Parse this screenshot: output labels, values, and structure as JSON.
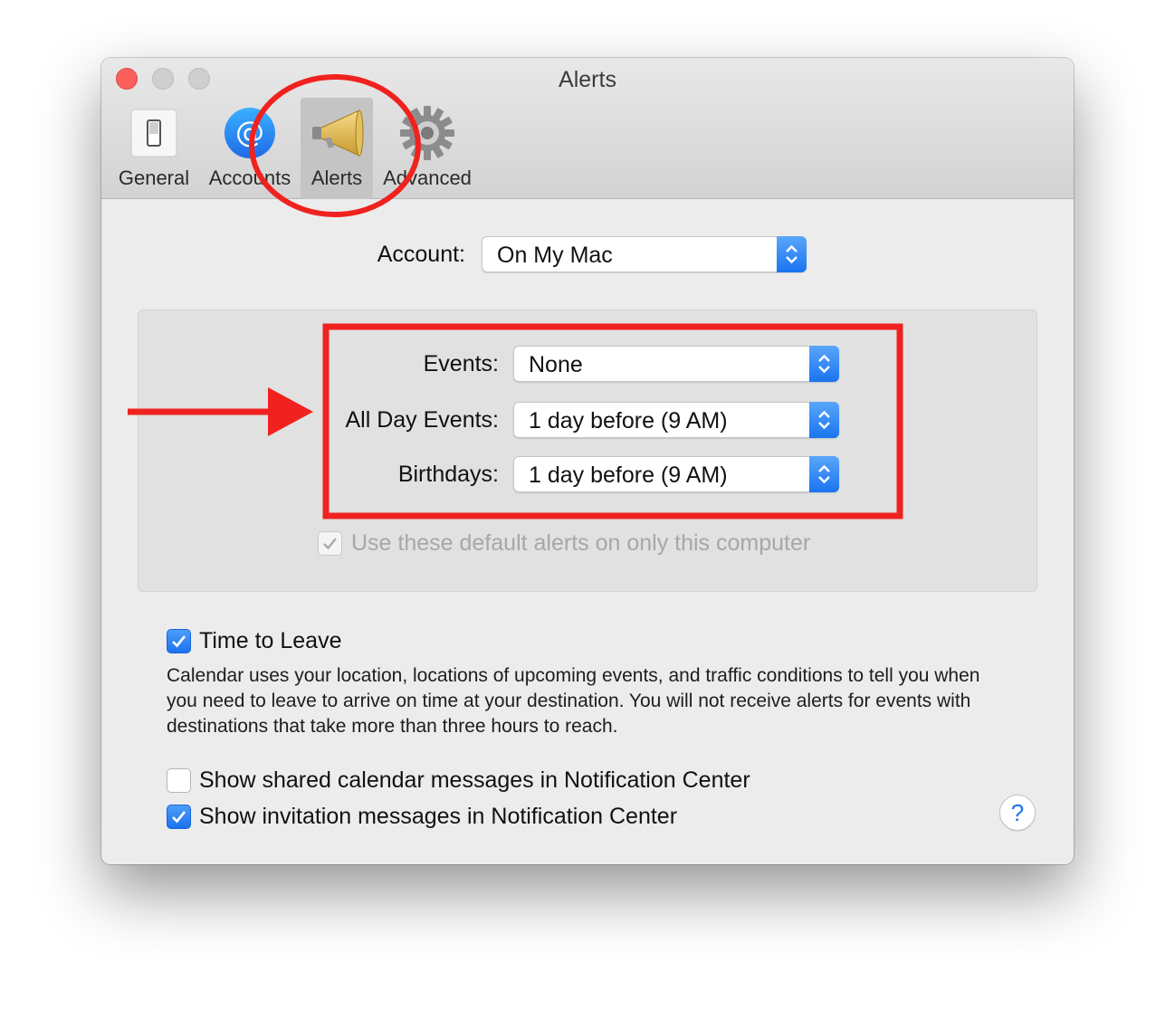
{
  "window": {
    "title": "Alerts",
    "controls": [
      "close",
      "minimize",
      "zoom"
    ]
  },
  "toolbar": {
    "items": [
      {
        "label": "General",
        "icon": "switch-icon",
        "selected": false
      },
      {
        "label": "Accounts",
        "icon": "at-sign-icon",
        "selected": false
      },
      {
        "label": "Alerts",
        "icon": "megaphone-icon",
        "selected": true
      },
      {
        "label": "Advanced",
        "icon": "gear-icon",
        "selected": false
      }
    ]
  },
  "account": {
    "label": "Account:",
    "value": "On My Mac"
  },
  "defaults": {
    "events_label": "Events:",
    "events_value": "None",
    "all_day_label": "All Day Events:",
    "all_day_value": "1 day before (9 AM)",
    "birthdays_label": "Birthdays:",
    "birthdays_value": "1 day before (9 AM)",
    "only_this_computer_label": "Use these default alerts on only this computer",
    "only_this_computer_checked": true,
    "only_this_computer_enabled": false
  },
  "time_to_leave": {
    "label": "Time to Leave",
    "checked": true,
    "description": "Calendar uses your location, locations of upcoming events, and traffic conditions to tell you when you need to leave to arrive on time at your destination. You will not receive alerts for events with destinations that take more than three hours to reach."
  },
  "shared_messages": {
    "label": "Show shared calendar messages in Notification Center",
    "checked": false
  },
  "invitation_messages": {
    "label": "Show invitation messages in Notification Center",
    "checked": true
  },
  "help": {
    "label": "?"
  },
  "annotation_color": "#f0221f",
  "accent": "#1a73ec"
}
